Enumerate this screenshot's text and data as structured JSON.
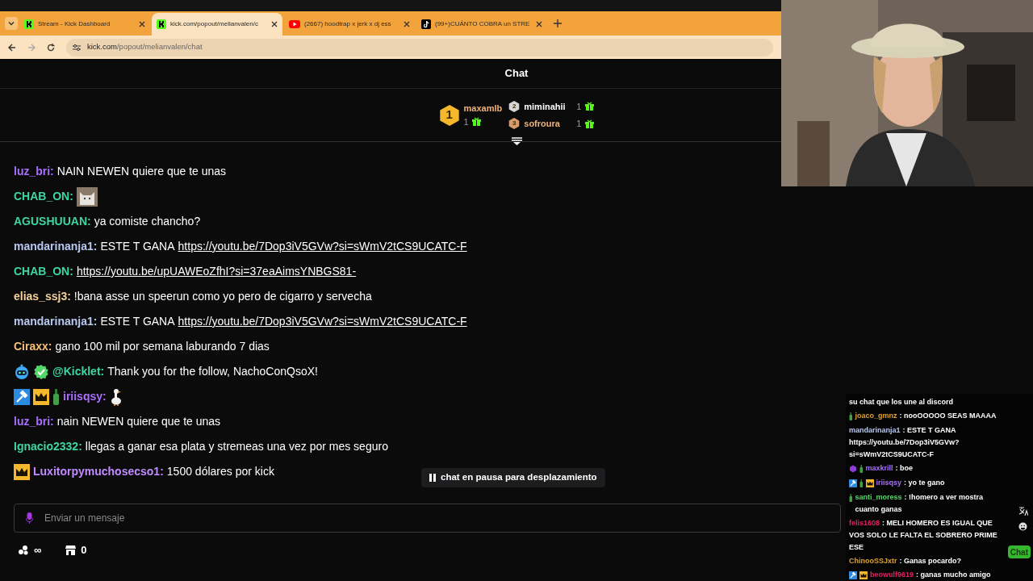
{
  "browser": {
    "tabs": [
      {
        "title": "Stream - Kick Dashboard",
        "kind": "kick",
        "selected": false
      },
      {
        "title": "kick.com/popout/melianvalen/c",
        "kind": "kick",
        "selected": true
      },
      {
        "title": "(2667) hoodtrap x jerk x dj ess",
        "kind": "youtube",
        "selected": false
      },
      {
        "title": "(99+)CUÁNTO COBRA un STRE",
        "kind": "tiktok",
        "selected": false
      }
    ],
    "url_host": "kick.com",
    "url_path": "/popout/melianvalen/chat"
  },
  "chat_title": "Chat",
  "leaderboard": [
    {
      "rank": "1",
      "user": "maxamlb",
      "count": "1",
      "color": "#f0b27a"
    },
    {
      "rank": "2",
      "user": "miminahii",
      "count": "1",
      "color": "#ffffff"
    },
    {
      "rank": "3",
      "user": "sofroura",
      "count": "1",
      "color": "#f0b27a"
    }
  ],
  "messages": [
    {
      "user": "luz_bri:",
      "color": "#a970ff",
      "text": "NAIN NEWEN quiere que te unas"
    },
    {
      "user": "CHAB_ON:",
      "color": "#3ed6a0",
      "emote": {
        "kind": "cat"
      }
    },
    {
      "user": "AGUSHUUAN:",
      "color": "#3ed6a0",
      "text": "ya comiste chancho?"
    },
    {
      "user": "mandarinanja1:",
      "color": "#b8c8f0",
      "text": "ESTE T GANA",
      "link": "https://youtu.be/7Dop3iV5GVw?si=sWmV2tCS9UCATC-F"
    },
    {
      "user": "CHAB_ON:",
      "color": "#3ed6a0",
      "link": "https://youtu.be/upUAWEoZfhI?si=37eaAimsYNBGS81-"
    },
    {
      "user": "elias_ssj3:",
      "color": "#f5d19a",
      "text": "!bana asse un speerun como yo pero de cigarro y servecha"
    },
    {
      "user": "mandarinanja1:",
      "color": "#b8c8f0",
      "text": "ESTE T GANA",
      "link": "https://youtu.be/7Dop3iV5GVw?si=sWmV2tCS9UCATC-F"
    },
    {
      "user": "Ciraxx:",
      "color": "#f5c07a",
      "text": "gano 100 mil por semana laburando 7 dias"
    },
    {
      "user": "@Kicklet:",
      "color": "#3ed6a0",
      "badges": [
        {
          "kind": "bot"
        },
        {
          "kind": "verified"
        }
      ],
      "text": "Thank you for the follow, NachoConQsoX!"
    },
    {
      "user": "iriisqsy:",
      "color": "#a970ff",
      "badges": [
        {
          "kind": "moderator"
        },
        {
          "kind": "crown"
        },
        {
          "kind": "bottle"
        }
      ],
      "emote": {
        "kind": "goose"
      }
    },
    {
      "user": "luz_bri:",
      "color": "#a970ff",
      "text": "nain NEWEN quiere que te unas"
    },
    {
      "user": "Ignacio2332:",
      "color": "#3ed6a0",
      "text": "llegas a ganar esa plata y stremeas una vez por mes seguro"
    },
    {
      "user": "Luxitorpymuchosecso1:",
      "color": "#c08cff",
      "badges": [
        {
          "kind": "crown"
        }
      ],
      "text": "1500 dólares por kick"
    }
  ],
  "paused_notice": "chat en pausa para desplazamiento",
  "input": {
    "placeholder": "Enviar un mensaje"
  },
  "footer": {
    "points": "∞",
    "store_count": "0"
  },
  "overlay_chat": [
    {
      "text": "su chat que los une al discord"
    },
    {
      "user": "joaco_gmnz",
      "color": "#e0a030",
      "badges": [
        {
          "kind": "bottle"
        }
      ],
      "text": ": nooOOOOO SEAS MAAAA"
    },
    {
      "user": "mandarinanja1",
      "color": "#b8c8f0",
      "text": ": ESTE T GANA https://youtu.be/7Dop3iV5GVw?si=sWmV2tCS9UCATC-F"
    },
    {
      "user": "maxkrill",
      "color": "#a970ff",
      "badges": [
        {
          "kind": "gem"
        },
        {
          "kind": "bottle"
        }
      ],
      "text": ": boe"
    },
    {
      "user": "iriisqsy",
      "color": "#a970ff",
      "badges": [
        {
          "kind": "moderator"
        },
        {
          "kind": "bottle"
        },
        {
          "kind": "crown"
        }
      ],
      "text": ": yo te gano"
    },
    {
      "user": "santi_moress",
      "color": "#53d769",
      "badges": [
        {
          "kind": "bottle"
        }
      ],
      "text": ": !homero a ver mostra cuanto ganas"
    },
    {
      "user": "felis1608",
      "color": "#e0245e",
      "text": ": MELI HOMERO ES IGUAL QUE VOS SOLO LE FALTA EL SOBRERO PRIME ESE"
    },
    {
      "user": "ChinooSSJxtr",
      "color": "#e0a030",
      "text": ": Ganas pocardo?"
    },
    {
      "user": "beowulf9619",
      "color": "#e0245e",
      "badges": [
        {
          "kind": "moderator"
        },
        {
          "kind": "crown"
        }
      ],
      "text": ": ganas mucho amigo"
    }
  ],
  "overlay_button": "Chat"
}
